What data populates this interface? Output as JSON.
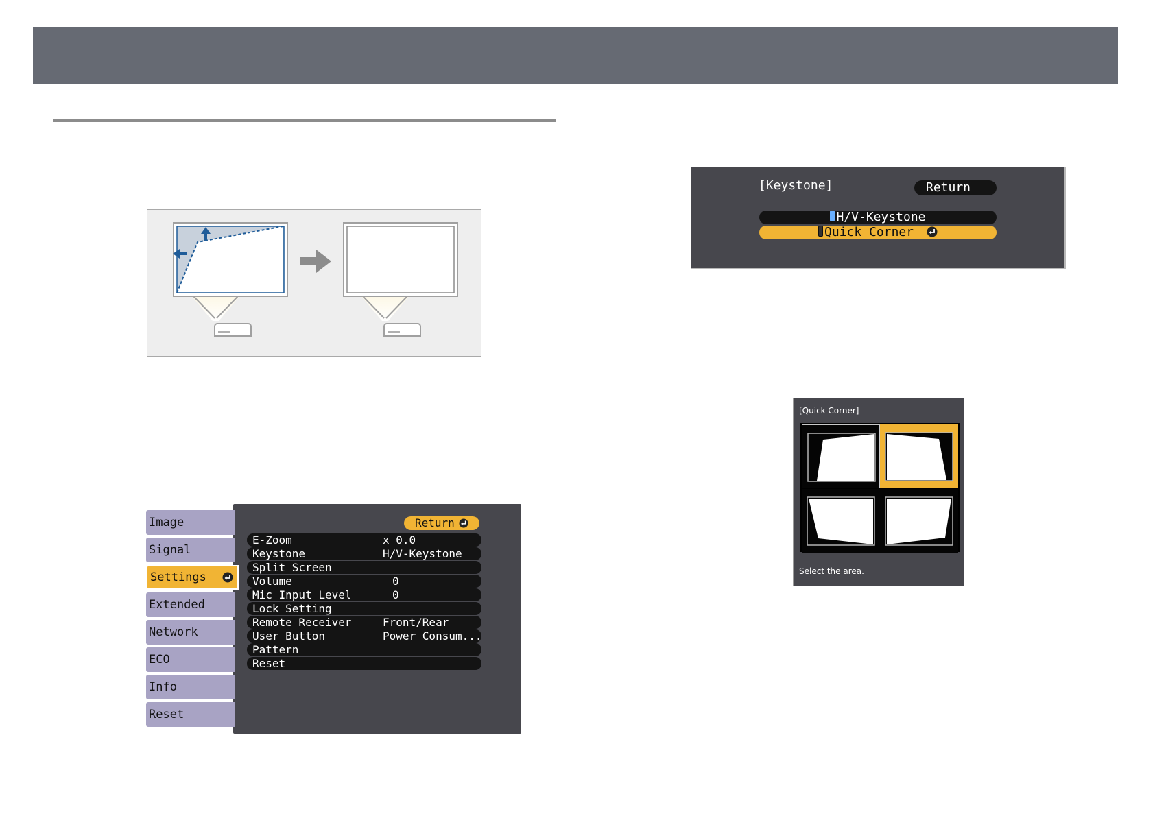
{
  "settings_menu": {
    "tabs": [
      "Image",
      "Signal",
      "Settings",
      "Extended",
      "Network",
      "ECO",
      "Info",
      "Reset"
    ],
    "active_tab": "Settings",
    "return_label": "Return",
    "rows": [
      {
        "label": "E-Zoom",
        "value": "x  0.0"
      },
      {
        "label": "Keystone",
        "value": "H/V-Keystone"
      },
      {
        "label": "Split Screen",
        "value": ""
      },
      {
        "label": "Volume",
        "value": "0"
      },
      {
        "label": "Mic Input Level",
        "value": "0"
      },
      {
        "label": "Lock Setting",
        "value": ""
      },
      {
        "label": "Remote Receiver",
        "value": "Front/Rear"
      },
      {
        "label": "User Button",
        "value": "Power Consum..."
      },
      {
        "label": "Pattern",
        "value": ""
      },
      {
        "label": "Reset",
        "value": ""
      }
    ]
  },
  "keystone_dialog": {
    "title": "[Keystone]",
    "return_label": "Return",
    "options": [
      "H/V-Keystone",
      "Quick Corner"
    ],
    "selected_option": "Quick Corner"
  },
  "quick_corner_dialog": {
    "title": "[Quick Corner]",
    "hint": "Select the area.",
    "selected_area": "top-right"
  },
  "colors": {
    "header_bar": "#666a73",
    "menu_accent": "#f1b434",
    "menu_tab": "#a8a3c4",
    "menu_panel": "#47474d",
    "keystone_arrow": "#1f5c99"
  }
}
